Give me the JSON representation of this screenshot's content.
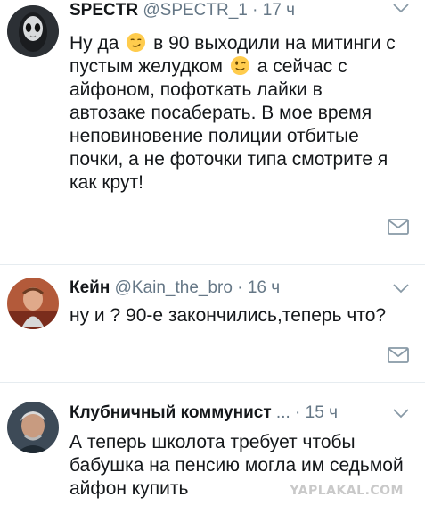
{
  "tweets": [
    {
      "name": "SPECTR",
      "handle": "@SPECTR_1",
      "dot": "·",
      "time": "17 ч",
      "avatar_icon": "masked-figure-avatar",
      "line1a": "Ну да",
      "line1b": "в 90 выходили на митинги с",
      "line2a": "пустым желудком",
      "line2b": "а сейчас с",
      "line3": "айфоном, пофоткать лайки в",
      "line4": "автозаке посаберать. В мое время",
      "line5": "неповиновение полиции отбитые",
      "line6": "почки,  а не фоточки типа смотрите я",
      "line7": "как крут!",
      "emoji1": "smirk-emoji",
      "emoji2": "wink-emoji"
    },
    {
      "name": "Кейн",
      "handle": "@Kain_the_bro",
      "dot": "·",
      "time": "16 ч",
      "avatar_icon": "wrestler-avatar",
      "line1": "ну и ? 90-е закончились,теперь что?"
    },
    {
      "name": "Клубничный коммунист",
      "ellipsis": "...",
      "dot": "·",
      "time": "15 ч",
      "avatar_icon": "grey-haired-man-avatar",
      "line1": "А теперь школота требует чтобы",
      "line2": "бабушка на пенсию могла им седьмой",
      "line3": "айфон купить"
    }
  ],
  "icons": {
    "caret": "chevron-down-icon",
    "dm": "envelope-icon"
  },
  "watermark": "YAPLAKAL.COM",
  "colors": {
    "text": "#14171a",
    "secondary": "#657786",
    "divider": "#e6ecf0"
  }
}
